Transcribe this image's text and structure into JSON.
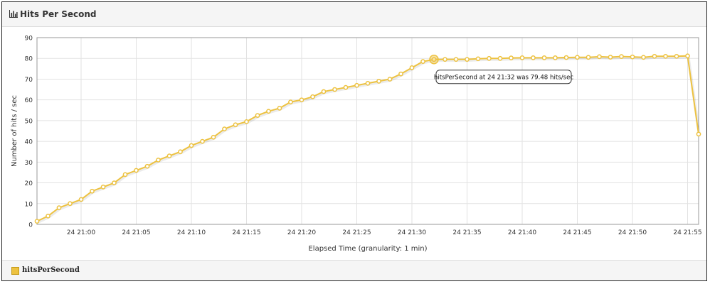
{
  "panel": {
    "title": "Hits Per Second",
    "icon": "bar-chart-icon"
  },
  "tooltip": {
    "text": "hitsPerSecond at 24 21:32 was 79.48 hits/sec"
  },
  "legend": {
    "label": "hitsPerSecond"
  },
  "colors": {
    "series": "#edc240",
    "series_dark": "#d4a520",
    "grid": "#e2e2e2"
  },
  "chart_data": {
    "type": "line",
    "xlabel": "Elapsed Time (granularity: 1 min)",
    "ylabel": "Number of hits / sec",
    "ylim": [
      0,
      90
    ],
    "yticks": [
      0,
      10,
      20,
      30,
      40,
      50,
      60,
      70,
      80,
      90
    ],
    "xlim": [
      "24 20:56",
      "24 21:56"
    ],
    "xticks": [
      "24 21:00",
      "24 21:05",
      "24 21:10",
      "24 21:15",
      "24 21:20",
      "24 21:25",
      "24 21:30",
      "24 21:35",
      "24 21:40",
      "24 21:45",
      "24 21:50",
      "24 21:55"
    ],
    "grid": true,
    "legend_position": "bottom",
    "highlight": {
      "x": "24 21:32",
      "y": 79.48
    },
    "series": [
      {
        "name": "hitsPerSecond",
        "x": [
          "24 20:56",
          "24 20:57",
          "24 20:58",
          "24 20:59",
          "24 21:00",
          "24 21:01",
          "24 21:02",
          "24 21:03",
          "24 21:04",
          "24 21:05",
          "24 21:06",
          "24 21:07",
          "24 21:08",
          "24 21:09",
          "24 21:10",
          "24 21:11",
          "24 21:12",
          "24 21:13",
          "24 21:14",
          "24 21:15",
          "24 21:16",
          "24 21:17",
          "24 21:18",
          "24 21:19",
          "24 21:20",
          "24 21:21",
          "24 21:22",
          "24 21:23",
          "24 21:24",
          "24 21:25",
          "24 21:26",
          "24 21:27",
          "24 21:28",
          "24 21:29",
          "24 21:30",
          "24 21:31",
          "24 21:32",
          "24 21:33",
          "24 21:34",
          "24 21:35",
          "24 21:36",
          "24 21:37",
          "24 21:38",
          "24 21:39",
          "24 21:40",
          "24 21:41",
          "24 21:42",
          "24 21:43",
          "24 21:44",
          "24 21:45",
          "24 21:46",
          "24 21:47",
          "24 21:48",
          "24 21:49",
          "24 21:50",
          "24 21:51",
          "24 21:52",
          "24 21:53",
          "24 21:54",
          "24 21:55",
          "24 21:56"
        ],
        "values": [
          1.5,
          4,
          8,
          10,
          12,
          16,
          18,
          20,
          24,
          26,
          28,
          31,
          33,
          35,
          38,
          40,
          42,
          46,
          48,
          49.5,
          52.5,
          54.5,
          56,
          59,
          60,
          61.5,
          64,
          65,
          66,
          67,
          68,
          69,
          70,
          72.5,
          75.5,
          78.5,
          79.48,
          79.5,
          79.5,
          79.5,
          79.8,
          80,
          80,
          80.2,
          80.3,
          80.3,
          80.3,
          80.3,
          80.4,
          80.5,
          80.5,
          80.8,
          80.6,
          80.9,
          80.7,
          80.5,
          81,
          81,
          81,
          81.2,
          43.5
        ]
      }
    ]
  }
}
